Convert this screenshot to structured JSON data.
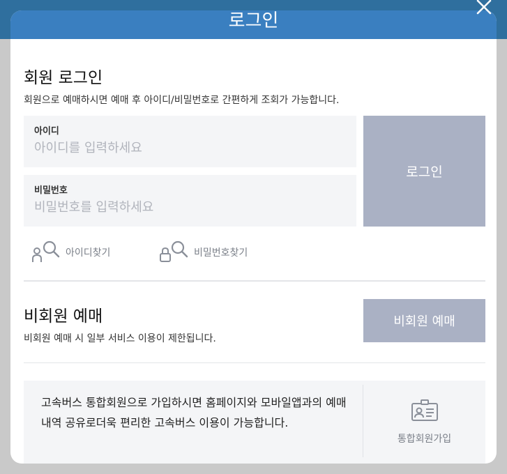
{
  "modal": {
    "title": "로그인",
    "close_label": "닫기"
  },
  "member_login": {
    "heading": "회원 로그인",
    "description": "회원으로 예매하시면 예매 후 아이디/비밀번호로 간편하게 조회가 가능합니다.",
    "id_label": "아이디",
    "id_placeholder": "아이디를 입력하세요",
    "id_value": "",
    "password_label": "비밀번호",
    "password_placeholder": "비밀번호를 입력하세요",
    "password_value": "",
    "login_button": "로그인",
    "find_id": "아이디찾기",
    "find_password": "비밀번호찾기"
  },
  "guest": {
    "heading": "비회원 예매",
    "description": "비회원 예매 시 일부 서비스 이용이 제한됩니다.",
    "button": "비회원 예매"
  },
  "banner": {
    "text": "고속버스 통합회원으로 가입하시면 홈페이지와 모바일앱과의 예매내역 공유로더욱 편리한 고속버스 이용이 가능합니다.",
    "join_label": "통합회원가입"
  },
  "colors": {
    "header": "#3a7fc0",
    "button_gray": "#aab1c4",
    "field_bg": "#f4f5f7",
    "icon_gray": "#8a8f99"
  }
}
